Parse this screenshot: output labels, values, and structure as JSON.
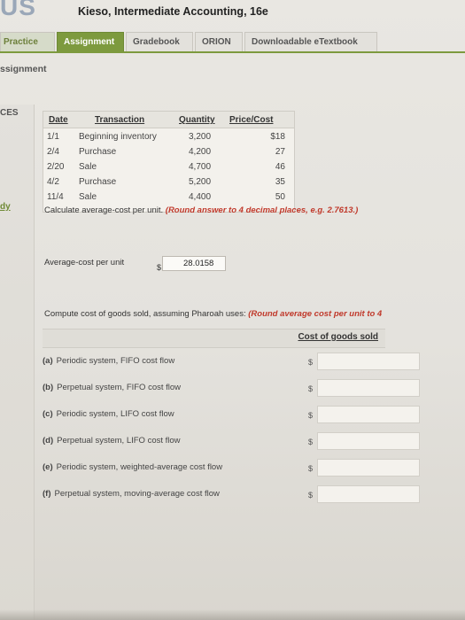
{
  "header": {
    "brand": "US",
    "course_title": "Kieso, Intermediate Accounting, 16e"
  },
  "tabs": [
    {
      "label": "Practice"
    },
    {
      "label": "Assignment"
    },
    {
      "label": "Gradebook"
    },
    {
      "label": "ORION"
    },
    {
      "label": "Downloadable eTextbook"
    }
  ],
  "breadcrumb": "ssignment",
  "sidebar": {
    "top_label": "CES",
    "mid_label": "dy"
  },
  "transactions": {
    "columns": [
      "Date",
      "Transaction",
      "Quantity",
      "Price/Cost"
    ],
    "rows": [
      {
        "date": "1/1",
        "transaction": "Beginning inventory",
        "quantity": "3,200",
        "price": "$18"
      },
      {
        "date": "2/4",
        "transaction": "Purchase",
        "quantity": "4,200",
        "price": "27"
      },
      {
        "date": "2/20",
        "transaction": "Sale",
        "quantity": "4,700",
        "price": "46"
      },
      {
        "date": "4/2",
        "transaction": "Purchase",
        "quantity": "5,200",
        "price": "35"
      },
      {
        "date": "11/4",
        "transaction": "Sale",
        "quantity": "4,400",
        "price": "50"
      }
    ]
  },
  "question1": {
    "text": "Calculate average-cost per unit. ",
    "hint": "(Round answer to 4 decimal places, e.g. 2.7613.)",
    "field_label": "Average-cost per unit",
    "currency": "$",
    "value": "28.0158"
  },
  "question2": {
    "text": "Compute cost of goods sold, assuming Pharoah uses: ",
    "hint": "(Round average cost per unit to 4",
    "column_header": "Cost of goods sold",
    "rows": [
      {
        "letter": "(a)",
        "label": "Periodic system, FIFO cost flow",
        "currency": "$"
      },
      {
        "letter": "(b)",
        "label": "Perpetual system, FIFO cost flow",
        "currency": "$"
      },
      {
        "letter": "(c)",
        "label": "Periodic system, LIFO cost flow",
        "currency": "$"
      },
      {
        "letter": "(d)",
        "label": "Perpetual system, LIFO cost flow",
        "currency": "$"
      },
      {
        "letter": "(e)",
        "label": "Periodic system, weighted-average cost flow",
        "currency": "$"
      },
      {
        "letter": "(f)",
        "label": "Perpetual system, moving-average cost flow",
        "currency": "$"
      }
    ]
  },
  "colors": {
    "accent": "#7d9a3e",
    "hint_red": "#c0392b"
  }
}
